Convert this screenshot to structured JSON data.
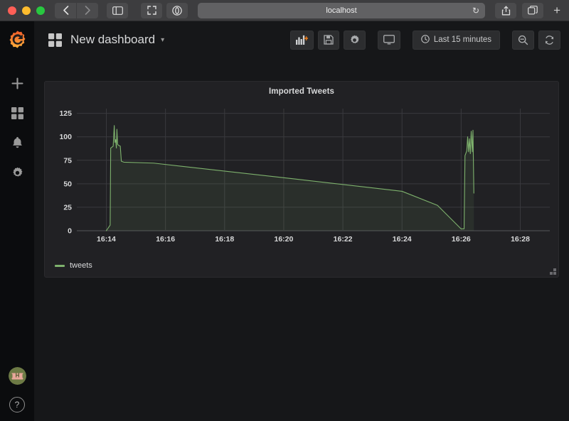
{
  "browser": {
    "window_controls": [
      "close",
      "minimize",
      "maximize"
    ],
    "back_label": "‹",
    "forward_label": "›",
    "sidebar_icon": "sidebar-icon",
    "expand_icon": "expand-icon",
    "privacy_icon": "privacy-report-icon",
    "url": "localhost",
    "reload_label": "↻",
    "share_icon": "share-icon",
    "tabs_icon": "tab-overview-icon",
    "new_tab_label": "+"
  },
  "sidebar": {
    "logo": "grafana-logo",
    "items": [
      {
        "name": "create",
        "icon": "plus-icon",
        "glyph": "+"
      },
      {
        "name": "dashboards",
        "icon": "dashboards-icon",
        "glyph": "⌸"
      },
      {
        "name": "alerting",
        "icon": "bell-icon",
        "glyph": "🔔"
      },
      {
        "name": "configuration",
        "icon": "gear-icon",
        "glyph": "⚙"
      }
    ],
    "bottom": {
      "avatar": "user-avatar",
      "help_label": "?"
    }
  },
  "navbar": {
    "dashboard_icon": "dashboard-grid-icon",
    "title": "New dashboard",
    "caret": "▾",
    "buttons": [
      {
        "name": "add-panel-button",
        "icon": "add-panel-icon",
        "label": ""
      },
      {
        "name": "save-dashboard-button",
        "icon": "save-icon",
        "label": ""
      },
      {
        "name": "dashboard-settings-button",
        "icon": "gear-icon",
        "label": ""
      },
      {
        "name": "cycle-view-mode-button",
        "icon": "monitor-icon",
        "label": ""
      }
    ],
    "time_picker": {
      "icon": "clock-icon",
      "label": "Last 15 minutes"
    },
    "zoom_out": {
      "name": "zoom-out-button",
      "icon": "search-minus-icon"
    },
    "refresh": {
      "name": "refresh-button",
      "icon": "refresh-icon"
    }
  },
  "panel": {
    "title": "Imported Tweets",
    "legend": [
      {
        "label": "tweets",
        "color": "#7eb26d"
      }
    ],
    "resize_handle": "panel-resize-handle"
  },
  "colors": {
    "series_green": "#7eb26d",
    "panel_bg": "#212124",
    "app_bg": "#161719",
    "grid": "#3a3a3e",
    "axis_text": "#d8d9da",
    "accent_orange": "#eb7b18"
  },
  "chart_data": {
    "type": "line",
    "title": "Imported Tweets",
    "xlabel": "",
    "ylabel": "",
    "grid": true,
    "legend_position": "bottom-left",
    "series": [
      {
        "name": "tweets",
        "color": "#7eb26d",
        "fill": true,
        "points": [
          [
            16.2333,
            0
          ],
          [
            16.2355,
            6
          ],
          [
            16.2358,
            88
          ],
          [
            16.2372,
            90
          ],
          [
            16.2378,
            112
          ],
          [
            16.2382,
            94
          ],
          [
            16.2386,
            97
          ],
          [
            16.239,
            88
          ],
          [
            16.2393,
            108
          ],
          [
            16.2397,
            92
          ],
          [
            16.2402,
            91
          ],
          [
            16.2412,
            90
          ],
          [
            16.2418,
            74
          ],
          [
            16.2432,
            73
          ],
          [
            16.26,
            72
          ],
          [
            16.34,
            55
          ],
          [
            16.4,
            42
          ],
          [
            16.42,
            27
          ],
          [
            16.4333,
            2
          ],
          [
            16.435,
            2
          ],
          [
            16.4355,
            80
          ],
          [
            16.4365,
            85
          ],
          [
            16.437,
            100
          ],
          [
            16.4375,
            84
          ],
          [
            16.438,
            98
          ],
          [
            16.4385,
            82
          ],
          [
            16.439,
            106
          ],
          [
            16.4396,
            84
          ],
          [
            16.44,
            107
          ],
          [
            16.4405,
            40
          ]
        ]
      }
    ],
    "x_ticks": [
      "16:14",
      "16:16",
      "16:18",
      "16:20",
      "16:22",
      "16:24",
      "16:26",
      "16:28"
    ],
    "y_ticks": [
      0,
      25,
      50,
      75,
      100,
      125
    ],
    "ylim": [
      0,
      130
    ],
    "xlim_labels": [
      "16:13",
      "16:29"
    ]
  }
}
